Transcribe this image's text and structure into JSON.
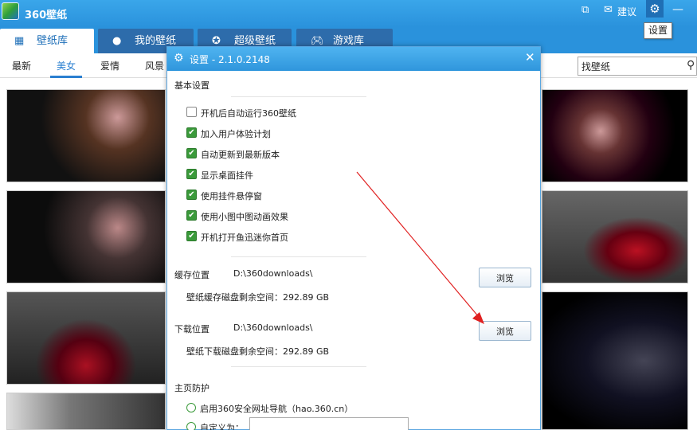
{
  "app": {
    "title": "360壁纸"
  },
  "titlebar": {
    "feedback_label": "建议",
    "settings_tooltip": "设置"
  },
  "tabs": [
    {
      "label": "壁纸库",
      "icon": "grid-icon"
    },
    {
      "label": "我的壁纸",
      "icon": "user-icon"
    },
    {
      "label": "超级壁纸",
      "icon": "star-badge-icon"
    },
    {
      "label": "游戏库",
      "icon": "gamepad-icon"
    }
  ],
  "categories": [
    "最新",
    "美女",
    "爱情",
    "风景"
  ],
  "active_category": "美女",
  "search": {
    "value": "找壁纸"
  },
  "dialog": {
    "title": "设置 - 2.1.0.2148",
    "basic_section": "基本设置",
    "options": [
      {
        "label": "开机后自动运行360壁纸",
        "checked": false
      },
      {
        "label": "加入用户体验计划",
        "checked": true
      },
      {
        "label": "自动更新到最新版本",
        "checked": true
      },
      {
        "label": "显示桌面挂件",
        "checked": true
      },
      {
        "label": "使用挂件悬停窗",
        "checked": true
      },
      {
        "label": "使用小图中图动画效果",
        "checked": true
      },
      {
        "label": "开机打开鱼迅迷你首页",
        "checked": true
      }
    ],
    "cache": {
      "label": "缓存位置",
      "path": "D:\\360downloads\\",
      "space": "壁纸缓存磁盘剩余空间：292.89 GB",
      "browse": "浏览"
    },
    "download": {
      "label": "下载位置",
      "path": "D:\\360downloads\\",
      "space": "壁纸下载磁盘剩余空间：292.89 GB",
      "browse": "浏览"
    },
    "homepage_section": "主页防护",
    "homepage_options": [
      {
        "label": "启用360安全网址导航（hao.360.cn）"
      },
      {
        "label": "自定义为："
      }
    ]
  },
  "colors": {
    "accent": "#2a92dc",
    "dark_tab": "#2d6cab",
    "check": "#3a9a3a",
    "annotation": "#e02020"
  }
}
